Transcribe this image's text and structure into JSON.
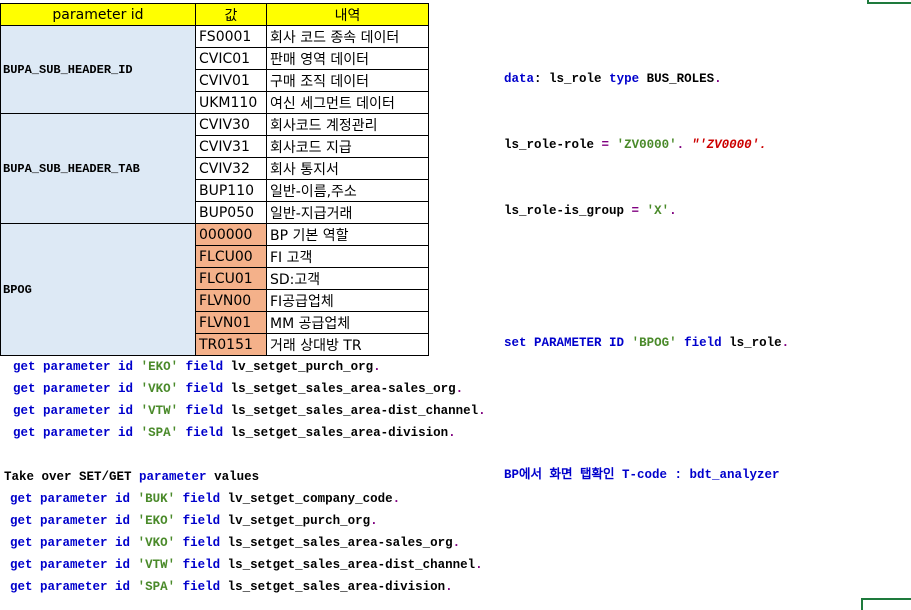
{
  "table": {
    "headers": [
      "parameter id",
      "값",
      "내역"
    ],
    "groups": [
      {
        "name": "BUPA_SUB_HEADER_ID",
        "rows": [
          {
            "value": "FS0001",
            "desc": "회사 코드 종속 데이터",
            "highlight": false
          },
          {
            "value": "CVIC01",
            "desc": "판매 영역 데이터",
            "highlight": false
          },
          {
            "value": "CVIV01",
            "desc": "구매 조직 데이터",
            "highlight": false
          },
          {
            "value": "UKM110",
            "desc": "여신 세그먼트 데이터",
            "highlight": false
          }
        ]
      },
      {
        "name": "BUPA_SUB_HEADER_TAB",
        "rows": [
          {
            "value": "CVIV30",
            "desc": "회사코드 계정관리",
            "highlight": false
          },
          {
            "value": "CVIV31",
            "desc": "회사코드 지급",
            "highlight": false
          },
          {
            "value": "CVIV32",
            "desc": "회사 통지서",
            "highlight": false
          },
          {
            "value": "BUP110",
            "desc": "일반-이름,주소",
            "highlight": false
          },
          {
            "value": "BUP050",
            "desc": "일반-지급거래",
            "highlight": false
          }
        ]
      },
      {
        "name": "BPOG",
        "rows": [
          {
            "value": "000000",
            "desc": "BP 기본 역할",
            "highlight": true
          },
          {
            "value": "FLCU00",
            "desc": "FI 고객",
            "highlight": true
          },
          {
            "value": "FLCU01",
            "desc": "SD:고객",
            "highlight": true
          },
          {
            "value": "FLVN00",
            "desc": "FI공급업체",
            "highlight": true
          },
          {
            "value": "FLVN01",
            "desc": "MM 공급업체",
            "highlight": true
          },
          {
            "value": "TR0151",
            "desc": "거래 상대방 TR",
            "highlight": true
          }
        ]
      }
    ]
  },
  "right_code": {
    "l1_kw1": "data",
    "l1_colon": ":",
    "l1_var": "ls_role",
    "l1_kw2": "type",
    "l1_type": "BUS_ROLES",
    "l1_end": ".",
    "l2_var": "ls_role-role",
    "l2_eq": "=",
    "l2_str": "'ZV0000'",
    "l2_dot": ".",
    "l2_comment": "\"'ZV0000'.",
    "l3_var": "ls_role-is_group",
    "l3_eq": "=",
    "l3_str": "'X'",
    "l3_dot": ".",
    "l4_kw1": "set",
    "l4_kw2": "PARAMETER ID",
    "l4_str": "'BPOG'",
    "l4_kw3": "field",
    "l4_var": "ls_role",
    "l4_dot": ".",
    "l5_text": "BP에서 화면 탭확인 T-code : bdt_analyzer"
  },
  "block1": [
    {
      "kw1": "get",
      "kw2": "parameter id",
      "id": "'EKO'",
      "kw3": "field",
      "var": "lv_setget_purch_org",
      "dot": "."
    },
    {
      "kw1": "get",
      "kw2": "parameter id",
      "id": "'VKO'",
      "kw3": "field",
      "var": "ls_setget_sales_area-sales_org",
      "dot": "."
    },
    {
      "kw1": "get",
      "kw2": "parameter id",
      "id": "'VTW'",
      "kw3": "field",
      "var": "ls_setget_sales_area-dist_channel",
      "dot": "."
    },
    {
      "kw1": "get",
      "kw2": "parameter id",
      "id": "'SPA'",
      "kw3": "field",
      "var": "ls_setget_sales_area-division",
      "dot": "."
    }
  ],
  "block2_heading": {
    "pre": "Take over SET/GET",
    "kw": "parameter",
    "post": "values"
  },
  "block2": [
    {
      "kw1": "get",
      "kw2": "parameter id",
      "id": "'BUK'",
      "kw3": "field",
      "var": "lv_setget_company_code",
      "dot": "."
    },
    {
      "kw1": "get",
      "kw2": "parameter id",
      "id": "'EKO'",
      "kw3": "field",
      "var": "lv_setget_purch_org",
      "dot": "."
    },
    {
      "kw1": "get",
      "kw2": "parameter id",
      "id": "'VKO'",
      "kw3": "field",
      "var": "ls_setget_sales_area-sales_org",
      "dot": "."
    },
    {
      "kw1": "get",
      "kw2": "parameter id",
      "id": "'VTW'",
      "kw3": "field",
      "var": "ls_setget_sales_area-dist_channel",
      "dot": "."
    },
    {
      "kw1": "get",
      "kw2": "parameter id",
      "id": "'SPA'",
      "kw3": "field",
      "var": "ls_setget_sales_area-division",
      "dot": "."
    }
  ],
  "colors": {
    "header": "#ffff00",
    "group": "#dde9f5",
    "highlight": "#f4b18a",
    "keyword": "#0000cc",
    "string": "#4a8a2a"
  }
}
